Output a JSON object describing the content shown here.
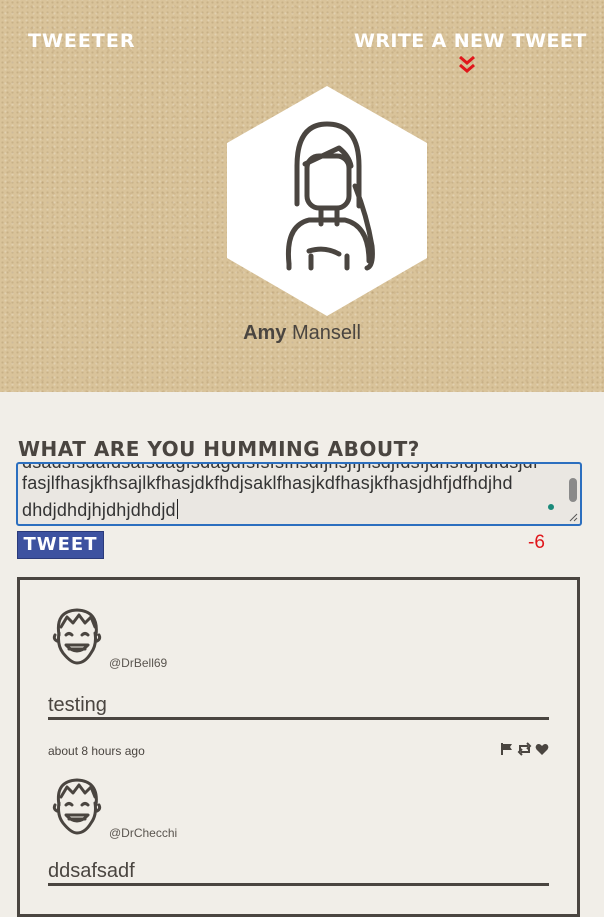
{
  "nav": {
    "brand": "TWEETER",
    "compose_link": "WRITE A NEW TWEET",
    "compose_icon": "double-chevron-down-icon"
  },
  "profile": {
    "first_name": "Amy",
    "last_name": "Mansell",
    "avatar_icon": "woman-avatar-icon"
  },
  "composer": {
    "prompt": "WHAT ARE YOU HUMMING ABOUT?",
    "text_cut_line": "dsadsfsdafdsafsdagfsdagdfsfsfsfhsdfjhsjfjhsdjfdsfjdhsfdjfdfdsjdf",
    "text_line1": "fasjlfhasjkfhsajlkfhasjdkfhdjsaklfhasjkdfhasjkfhasjdhfjdfhdjhd",
    "text_line2": "dhdjdhdjhjdhjdhdjd",
    "tweet_button": "TWEET",
    "char_counter": "-6",
    "counter_color": "#e0161b",
    "accent_color": "#3d52a0",
    "focus_color": "#2c6fbf"
  },
  "feed": {
    "tweets": [
      {
        "handle": "@DrBell69",
        "text": "testing",
        "timestamp": "about 8 hours ago",
        "avatar_icon": "man-avatar-icon",
        "actions": [
          "flag-icon",
          "retweet-icon",
          "heart-icon"
        ]
      },
      {
        "handle": "@DrChecchi",
        "text": "ddsafsadf",
        "avatar_icon": "man-avatar-icon"
      }
    ]
  }
}
